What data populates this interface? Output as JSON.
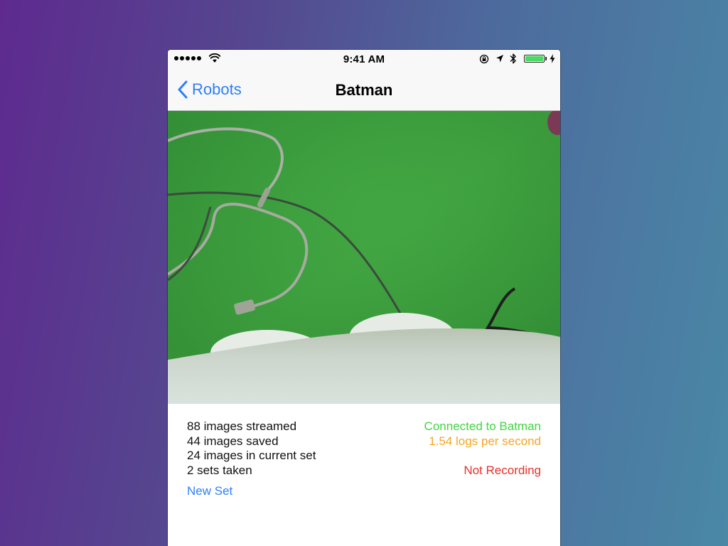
{
  "status_bar": {
    "time": "9:41 AM",
    "signal_bars": 5,
    "battery_level": 1.0,
    "icons": [
      "wifi-icon",
      "rotation-lock-icon",
      "location-arrow-icon",
      "bluetooth-icon",
      "battery-icon",
      "charging-icon"
    ]
  },
  "nav": {
    "back_label": "Robots",
    "title": "Batman"
  },
  "camera": {
    "scene": "robot-camera-feed"
  },
  "stats": {
    "streamed": "88 images streamed",
    "saved": "44 images saved",
    "current_set": "24 images in current set",
    "sets_taken": "2 sets taken"
  },
  "actions": {
    "new_set_label": "New Set"
  },
  "connection": {
    "status": "Connected to Batman",
    "logs_rate": "1.54 logs per second",
    "recording": "Not Recording"
  },
  "colors": {
    "accent": "#2d7ff9",
    "connected": "#41d641",
    "logs": "#f5a623",
    "recording": "#e8302a",
    "battery": "#4cd964"
  }
}
